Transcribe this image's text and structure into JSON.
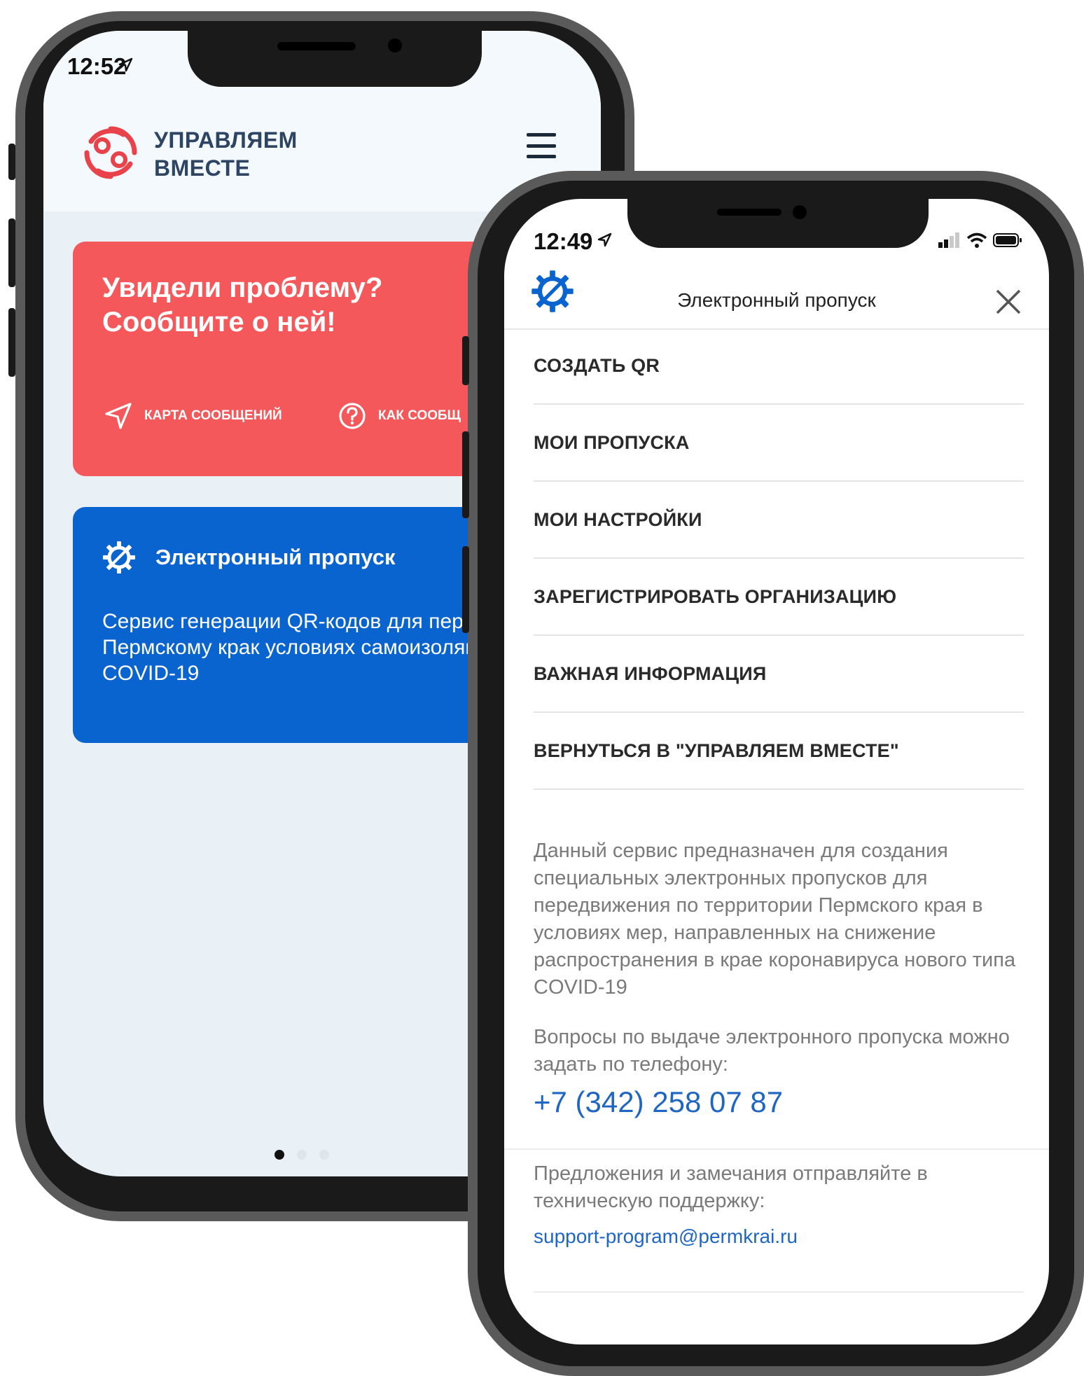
{
  "back_phone": {
    "status_time": "12:52",
    "app_name_line1": "УПРАВЛЯЕМ",
    "app_name_line2": "ВМЕСТЕ",
    "report_card": {
      "title": "Увидели проблему? Сообщите о ней!",
      "link_map": "КАРТА СООБЩЕНИЙ",
      "link_howto": "КАК СООБЩ"
    },
    "pass_card": {
      "title": "Электронный пропуск",
      "description": "Сервис генерации QR-кодов для передвижения по Пермскому крак условиях самоизоляции и вспышк COVID-19"
    },
    "page_indicator": {
      "count": 3,
      "active": 1
    }
  },
  "front_phone": {
    "status_time": "12:49",
    "header_title": "Электронный пропуск",
    "menu": [
      {
        "label": "СОЗДАТЬ QR"
      },
      {
        "label": "МОИ ПРОПУСКА"
      },
      {
        "label": "МОИ НАСТРОЙКИ"
      },
      {
        "label": "ЗАРЕГИСТРИРОВАТЬ ОРГАНИЗАЦИЮ"
      },
      {
        "label": "ВАЖНАЯ ИНФОРМАЦИЯ"
      },
      {
        "label": "ВЕРНУТЬСЯ В \"УПРАВЛЯЕМ ВМЕСТЕ\""
      }
    ],
    "info_text": "Данный сервис предназначен для создания специальных электронных пропусков для передвижения по территории Пермского края в условиях мер, направленных на снижение распространения в крае коронавируса нового типа COVID-19",
    "questions_text": "Вопросы по выдаче электронного пропуска можно задать по телефону:",
    "phone": "+7 (342) 258 07 87",
    "suggestions_text": "Предложения и замечания отправляйте в техническую поддержку:",
    "email": "support-program@permkrai.ru"
  },
  "colors": {
    "red_card": "#f4585a",
    "blue_card": "#0a64d0",
    "link_blue": "#1f66c4",
    "logo_red": "#e8434a",
    "logo_navy": "#2d4462"
  },
  "icons": [
    "location-arrow-icon",
    "wifi-icon",
    "signal-icon",
    "battery-icon",
    "hamburger-icon",
    "send-icon",
    "question-circle-icon",
    "gear-icon",
    "close-icon"
  ]
}
